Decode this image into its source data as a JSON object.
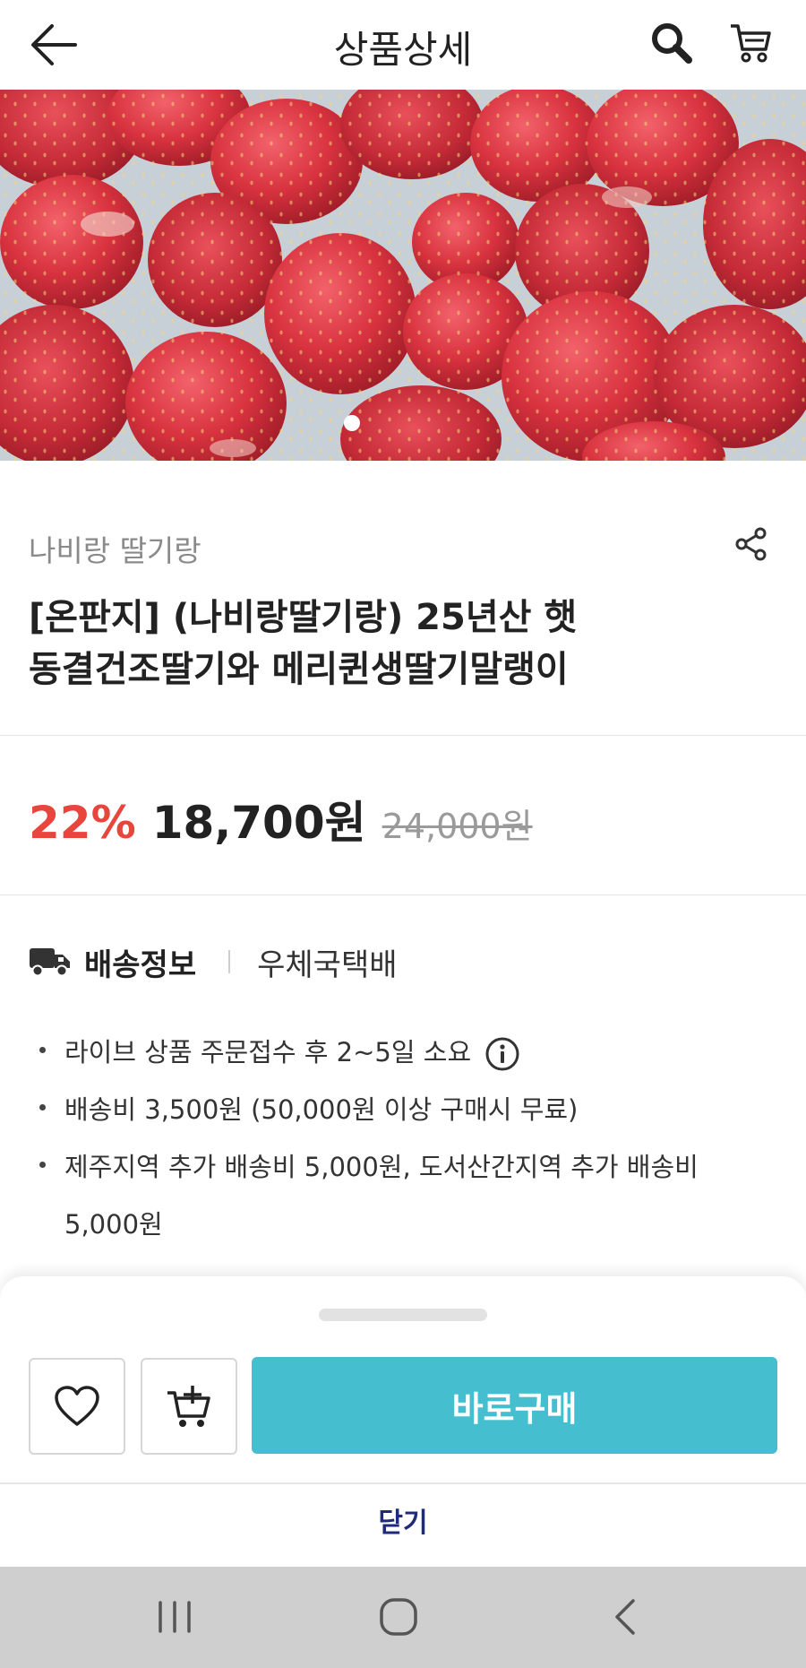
{
  "header": {
    "title": "상품상세",
    "icons": {
      "back": "arrow-left-icon",
      "search": "search-icon",
      "cart": "cart-icon"
    }
  },
  "hero": {
    "image": "frozen-strawberries-photo",
    "slide_count": 1,
    "active_slide": 1
  },
  "product": {
    "seller": "나비랑 딸기랑",
    "title_line1": "[온판지] (나비랑딸기랑) 25년산 햇",
    "title_line2": "동결건조딸기와 메리퀸생딸기말랭이",
    "discount": "22%",
    "price": "18,700원",
    "original_price": "24,000원"
  },
  "shipping": {
    "label": "배송정보",
    "carrier": "우체국택배",
    "lines": {
      "b1": "라이브 상품 주문접수 후 2~5일 소요",
      "b2": "배송비 3,500원 (50,000원 이상 구매시 무료)",
      "b3a": "제주지역 추가 배송비 5,000원, 도서산간지역 추가 배송비",
      "b3b": "5,000원"
    }
  },
  "actions": {
    "buy_label": "바로구매",
    "close_label": "닫기"
  },
  "colors": {
    "accent": "#45bfd0",
    "discount": "#e8453c",
    "close_text": "#1f2a7a"
  }
}
